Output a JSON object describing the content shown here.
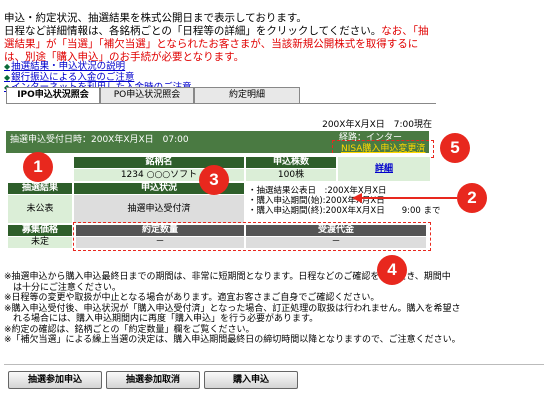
{
  "intro": {
    "line1": "申込・約定状況、抽選結果を株式公開日まで表示しております。",
    "line2_black": "日程など詳細情報は、各銘柄ごとの「日程等の詳細」をクリックしてください。",
    "line2_red": "なお、「抽",
    "line3": "選結果」が「当選」「補欠当選」となられたお客さまが、当該新規公開株式を取得するに",
    "line4": "は、別途「購入申込」のお手続が必要となります。"
  },
  "links": [
    "抽選結果・申込状況の説明",
    "銀行振込による入金のご注意",
    "インターネットを利用した入金時のご注意"
  ],
  "tabs": [
    "IPO申込状況照会",
    "PO申込状況照会",
    "約定明細"
  ],
  "current_time": "200X年X月X日　7:00現在",
  "panel": {
    "received_label": "抽選申込受付日時：200X年X月X日　07:00",
    "account_type": "経路：インター",
    "nisa_button": "NISA購入申込変更済"
  },
  "table": {
    "stock_name_header": "銘柄名",
    "stock_name": "1234 ○○○ソフト",
    "apply_qty_header": "申込株数",
    "apply_qty": "100株",
    "detail_link": "詳細",
    "lottery_result_header": "抽選結果",
    "lottery_result": "未公表",
    "apply_status_header": "申込状況",
    "apply_status": "抽選申込受付済",
    "schedule": [
      "・抽選結果公表日　:200X年X月X日",
      "・購入申込期間(始):200X年X月X日",
      "・購入申込期間(終):200X年X月X日　　9:00 まで"
    ],
    "offer_price_header": "募集価格",
    "offer_price": "未定",
    "contract_qty_header": "約定数量",
    "contract_qty": "－",
    "amount_header": "受渡代金",
    "amount": "－"
  },
  "notes": [
    "※抽選申込から購入申込最終日までの期間は、非常に短期間となります。日程などのご確認をいただき、期間中",
    "　は十分にご注意ください。",
    "※日程等の変更や取扱が中止となる場合があります。適宜お客さまご自身でご確認ください。",
    "※購入申込受付後、申込状況が「購入申込受付済」となった場合、訂正処理の取扱は行われません。購入を希望さ",
    "　れる場合には、購入申込期間内に再度「購入申込」を行う必要があります。",
    "※約定の確認は、銘柄ごとの「約定数量」欄をご覧ください。",
    "※「補欠当選」による繰上当選の決定は、購入申込期間最終日の締切時間以降となりますので、ご注意ください。"
  ],
  "buttons": [
    "抽選参加申込",
    "抽選参加取消",
    "購入申込"
  ],
  "callouts": [
    "1",
    "2",
    "3",
    "4",
    "5"
  ],
  "colors": {
    "accent_green": "#2e5e2a",
    "light_green": "#dbeed7",
    "callout_red": "#e8281e"
  }
}
